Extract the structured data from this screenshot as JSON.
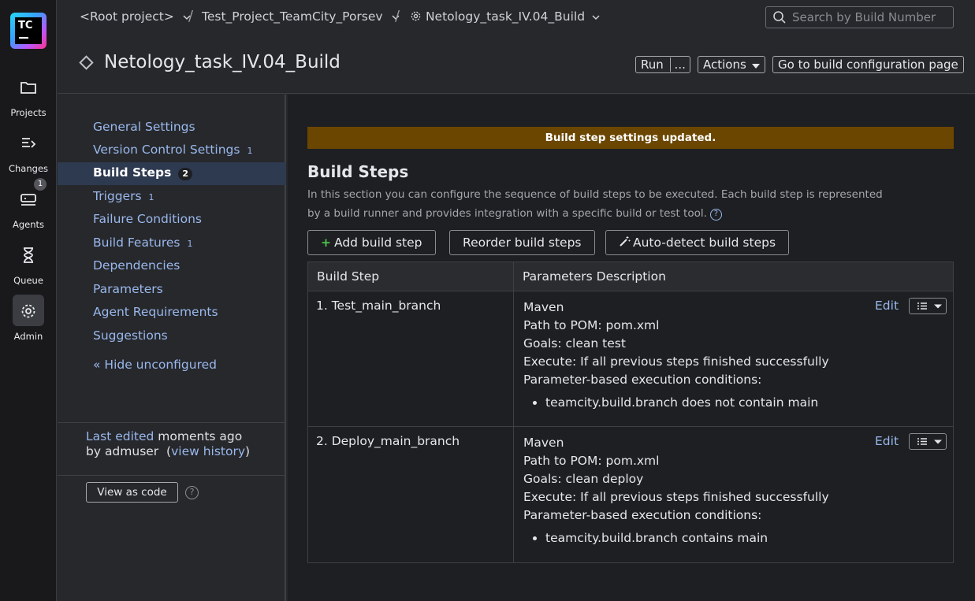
{
  "rail": {
    "logo_text": "TC",
    "items": [
      {
        "label": "Projects",
        "icon": "folder-icon"
      },
      {
        "label": "Changes",
        "icon": "changes-icon"
      },
      {
        "label": "Agents",
        "icon": "agents-icon",
        "badge": "1"
      },
      {
        "label": "Queue",
        "icon": "hourglass-icon"
      },
      {
        "label": "Admin",
        "icon": "gear-icon"
      }
    ]
  },
  "breadcrumb": {
    "root": "<Root project>",
    "project": "Test_Project_TeamCity_Porsev",
    "config": "Netology_task_IV.04_Build"
  },
  "search": {
    "placeholder": "Search by Build Number"
  },
  "header": {
    "title": "Netology_task_IV.04_Build",
    "run": "Run",
    "run_more": "...",
    "actions": "Actions",
    "goto": "Go to build configuration page"
  },
  "sidebar": {
    "items": [
      {
        "label": "General Settings",
        "count": ""
      },
      {
        "label": "Version Control Settings",
        "count": "1"
      },
      {
        "label": "Build Steps",
        "count": "2"
      },
      {
        "label": "Triggers",
        "count": "1"
      },
      {
        "label": "Failure Conditions",
        "count": ""
      },
      {
        "label": "Build Features",
        "count": "1"
      },
      {
        "label": "Dependencies",
        "count": ""
      },
      {
        "label": "Parameters",
        "count": ""
      },
      {
        "label": "Agent Requirements",
        "count": ""
      },
      {
        "label": "Suggestions",
        "count": ""
      }
    ],
    "hide_unconfigured": "« Hide unconfigured",
    "last_edited_link": "Last edited",
    "last_edited_text": " moments ago",
    "by_user": "by admuser",
    "view_history": "view history",
    "view_as_code": "View as code"
  },
  "main": {
    "alert": "Build step settings updated.",
    "title": "Build Steps",
    "description": "In this section you can configure the sequence of build steps to be executed. Each build step is represented by a build runner and provides integration with a specific build or test tool.",
    "add_step": "Add build step",
    "reorder": "Reorder build steps",
    "autodetect": "Auto-detect build steps",
    "table": {
      "col1": "Build Step",
      "col2": "Parameters Description",
      "edit_label": "Edit",
      "rows": [
        {
          "name": "1. Test_main_branch",
          "runner": "Maven",
          "pom": "Path to POM: pom.xml",
          "goals": "Goals: clean test",
          "execute": "Execute: If all previous steps finished successfully",
          "conditions_label": "Parameter-based execution conditions:",
          "condition": "teamcity.build.branch does not contain main"
        },
        {
          "name": "2. Deploy_main_branch",
          "runner": "Maven",
          "pom": "Path to POM: pom.xml",
          "goals": "Goals: clean deploy",
          "execute": "Execute: If all previous steps finished successfully",
          "conditions_label": "Parameter-based execution conditions:",
          "condition": "teamcity.build.branch contains main"
        }
      ]
    }
  }
}
